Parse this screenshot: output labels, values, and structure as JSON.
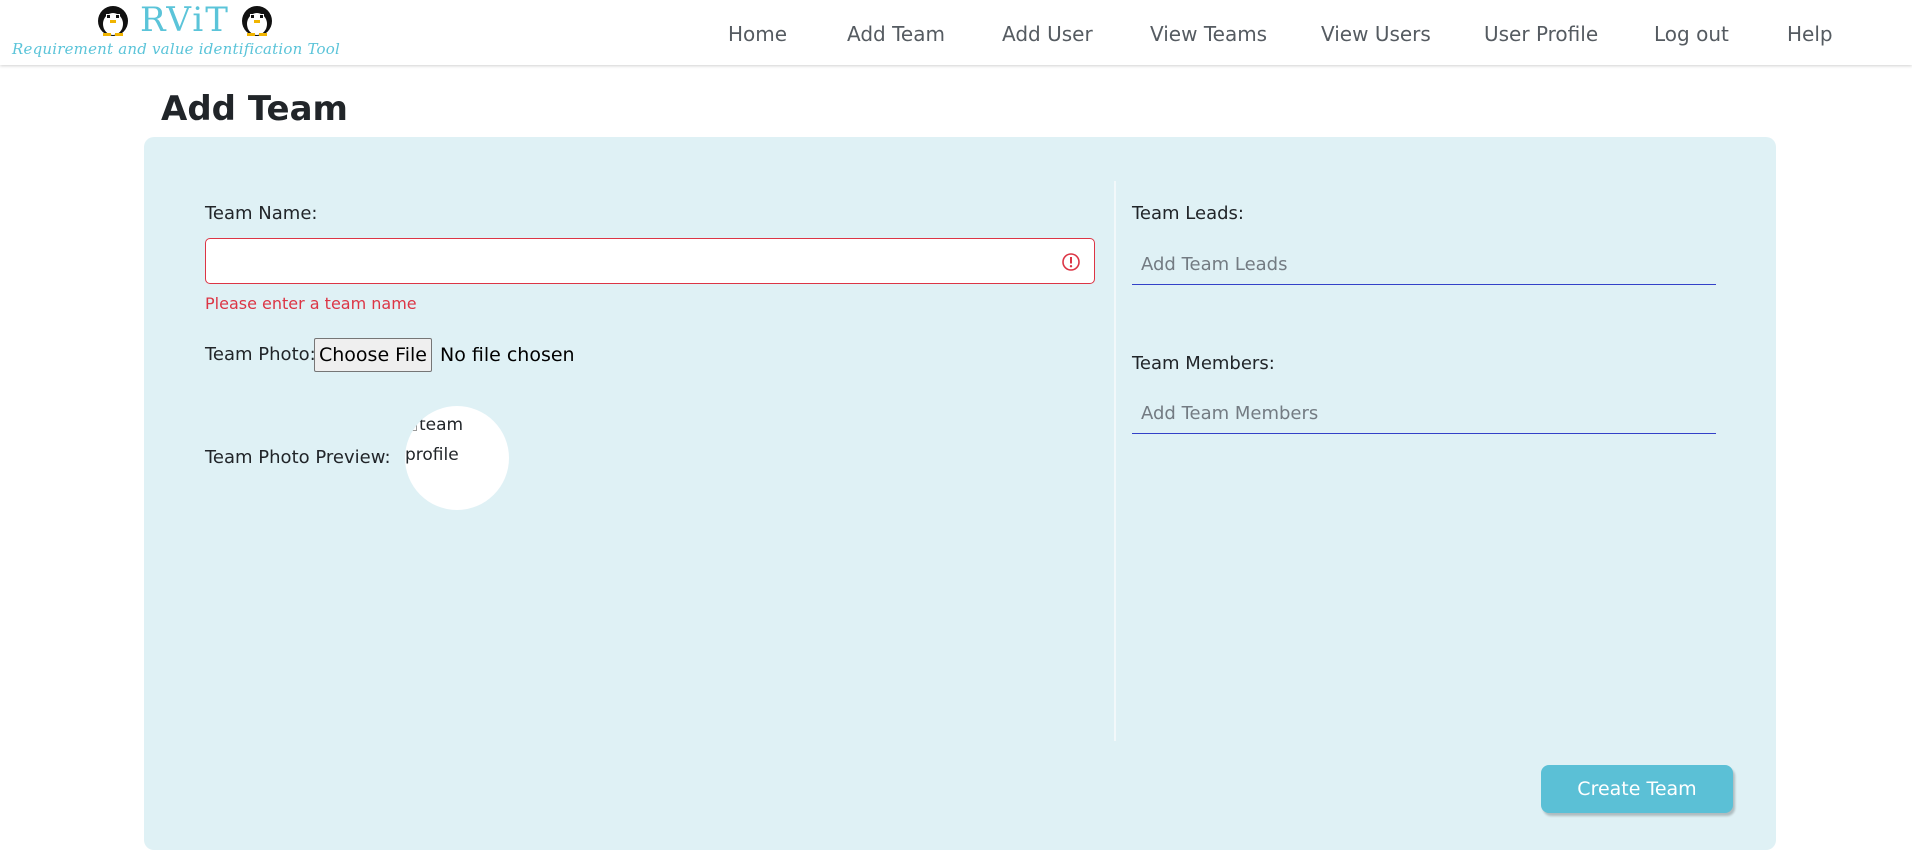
{
  "brand": {
    "name": "RViT",
    "tagline": "Requirement and value identification Tool",
    "logo_icon": "penguin-icon"
  },
  "nav": {
    "items": [
      {
        "label": "Home"
      },
      {
        "label": "Add Team"
      },
      {
        "label": "Add User"
      },
      {
        "label": "View Teams"
      },
      {
        "label": "View Users"
      },
      {
        "label": "User Profile"
      },
      {
        "label": "Log out"
      },
      {
        "label": "Help"
      }
    ]
  },
  "page": {
    "title": "Add Team"
  },
  "form": {
    "team_name": {
      "label": "Team Name:",
      "value": "",
      "error": "Please enter a team name",
      "error_icon": "alert-circle-icon"
    },
    "team_photo": {
      "label": "Team Photo:",
      "button_label": "Choose File",
      "status": "No file chosen"
    },
    "team_photo_preview": {
      "label": "Team Photo Preview:",
      "alt_text": "team profile"
    },
    "team_leads": {
      "label": "Team Leads:",
      "placeholder": "Add Team Leads",
      "value": ""
    },
    "team_members": {
      "label": "Team Members:",
      "placeholder": "Add Team Members",
      "value": ""
    },
    "submit_label": "Create Team"
  },
  "colors": {
    "accent": "#5bc4d9",
    "card_background": "#dff1f5",
    "error": "#dc3545",
    "input_underline": "#3341c8",
    "button": "#5bc0d6"
  }
}
